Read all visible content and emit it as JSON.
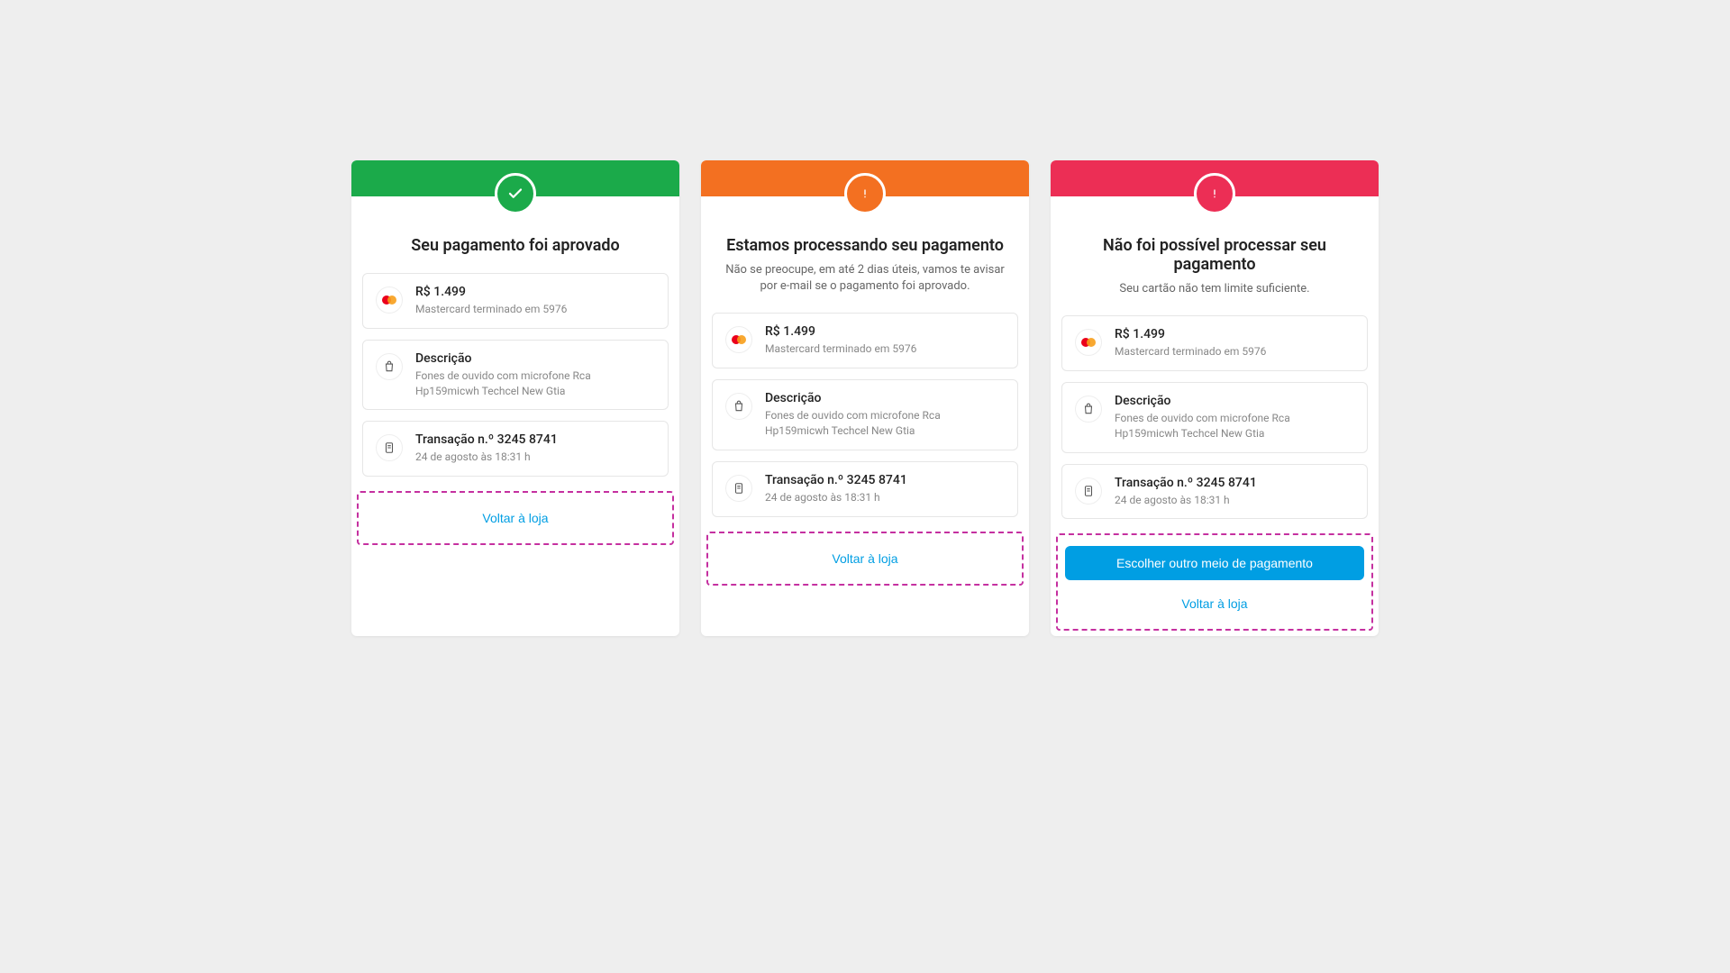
{
  "colors": {
    "success": "#1baa4a",
    "warning": "#f37021",
    "error": "#ec2e55",
    "link": "#009ee3"
  },
  "cards": [
    {
      "status": "success",
      "title": "Seu pagamento foi aprovado",
      "subtitle": "",
      "payment_amount": "R$ 1.499",
      "payment_method": "Mastercard terminado em 5976",
      "description_label": "Descrição",
      "description_text": "Fones de ouvido com microfone Rca Hp159micwh Techcel New Gtia",
      "transaction_label": "Transação n.º 3245 8741",
      "transaction_time": "24 de agosto às 18:31 h",
      "primary_button": "",
      "back_button": "Voltar à loja"
    },
    {
      "status": "warning",
      "title": "Estamos processando seu pagamento",
      "subtitle": "Não se preocupe, em até 2 dias úteis,  vamos te avisar por e-mail se o pagamento foi aprovado.",
      "payment_amount": "R$ 1.499",
      "payment_method": "Mastercard terminado em 5976",
      "description_label": "Descrição",
      "description_text": "Fones de ouvido com microfone Rca Hp159micwh Techcel New Gtia",
      "transaction_label": "Transação n.º 3245 8741",
      "transaction_time": "24 de agosto às 18:31 h",
      "primary_button": "",
      "back_button": "Voltar à loja"
    },
    {
      "status": "error",
      "title": "Não foi possível processar seu pagamento",
      "subtitle": "Seu cartão não tem limite suficiente.",
      "payment_amount": "R$ 1.499",
      "payment_method": "Mastercard terminado em 5976",
      "description_label": "Descrição",
      "description_text": "Fones de ouvido com microfone Rca Hp159micwh Techcel New Gtia",
      "transaction_label": "Transação n.º 3245 8741",
      "transaction_time": "24 de agosto às 18:31 h",
      "primary_button": "Escolher outro meio de pagamento",
      "back_button": "Voltar à loja"
    }
  ]
}
